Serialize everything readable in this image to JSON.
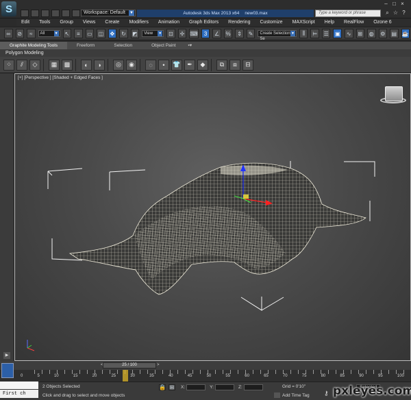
{
  "titlebar": {
    "logo_glyph": "S",
    "workspace_label": "Workspace: Default",
    "app_title": "Autodesk 3ds Max  2013 x64",
    "file_name": "new03.max",
    "search_placeholder": "Type a keyword or phrase"
  },
  "menu": [
    "Edit",
    "Tools",
    "Group",
    "Views",
    "Create",
    "Modifiers",
    "Animation",
    "Graph Editors",
    "Rendering",
    "Customize",
    "MAXScript",
    "Help",
    "RealFlow",
    "Ozone 6"
  ],
  "toolbar": {
    "filter_value": "All",
    "refcoord_value": "View",
    "selection_set_value": "Create Selection Se"
  },
  "ribbon": {
    "tabs": [
      "Graphite Modeling Tools",
      "Freeform",
      "Selection",
      "Object Paint"
    ],
    "active_tab": "Graphite Modeling Tools",
    "sub_label": "Polygon Modeling"
  },
  "viewport": {
    "label": "[+] [Perspective ] [Shaded + Edged Faces ]"
  },
  "timeline": {
    "frame_indicator": "25 / 100",
    "ticks": [
      "0",
      "5",
      "10",
      "15",
      "20",
      "25",
      "30",
      "35",
      "40",
      "45",
      "50",
      "55",
      "60",
      "65",
      "70",
      "75",
      "80",
      "85",
      "90",
      "95",
      "100"
    ]
  },
  "status": {
    "maxscript_text": "First ch",
    "selection_text": "2 Objects Selected",
    "prompt_text": "Click and drag to select and move objects",
    "x_label": "X:",
    "y_label": "Y:",
    "z_label": "Z:",
    "grid_text": "Grid = 0'10\"",
    "add_time_tag": "Add Time Tag",
    "selected_label": "Selected",
    "watermark": "pxleyes.com"
  },
  "colors": {
    "accent_blue": "#2f6fc2",
    "mesh_color": "#f1eddc",
    "viewport_bg": "#4a4a4a"
  }
}
